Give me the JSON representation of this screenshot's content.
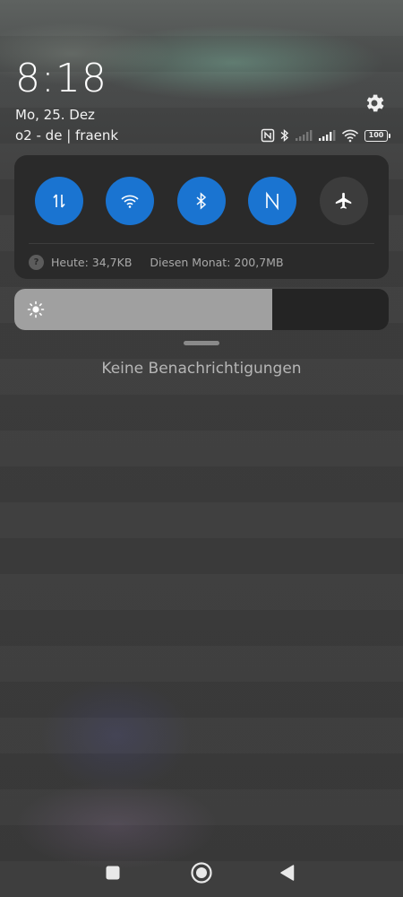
{
  "status": {
    "time": "8:18",
    "date": "Mo, 25. Dez",
    "carrier": "o2 - de | fraenk",
    "battery": "100",
    "icons": [
      "nfc-icon",
      "bluetooth-icon",
      "signal-icon",
      "signal-icon",
      "wifi-icon",
      "battery-icon"
    ]
  },
  "settings": {
    "icon": "gear-icon"
  },
  "quick_settings": {
    "tiles": [
      {
        "name": "mobile-data",
        "icon": "mobile-data-icon",
        "active": true
      },
      {
        "name": "wifi",
        "icon": "wifi-icon",
        "active": true
      },
      {
        "name": "bluetooth",
        "icon": "bluetooth-icon",
        "active": true
      },
      {
        "name": "nfc",
        "icon": "nfc-icon",
        "active": true
      },
      {
        "name": "airplane-mode",
        "icon": "airplane-icon",
        "active": false
      }
    ],
    "data_usage": {
      "today": "Heute: 34,7KB",
      "month": "Diesen Monat: 200,7MB"
    }
  },
  "brightness": {
    "level": 0.69,
    "icon": "sun-icon"
  },
  "notifications": {
    "empty_text": "Keine Benachrichtigungen"
  },
  "navigation": {
    "buttons": [
      "recents-button",
      "home-button",
      "back-button"
    ]
  },
  "colors": {
    "accent": "#1a74d1",
    "panel": "#2a2a2a",
    "tile_off": "#3c3c3c"
  }
}
